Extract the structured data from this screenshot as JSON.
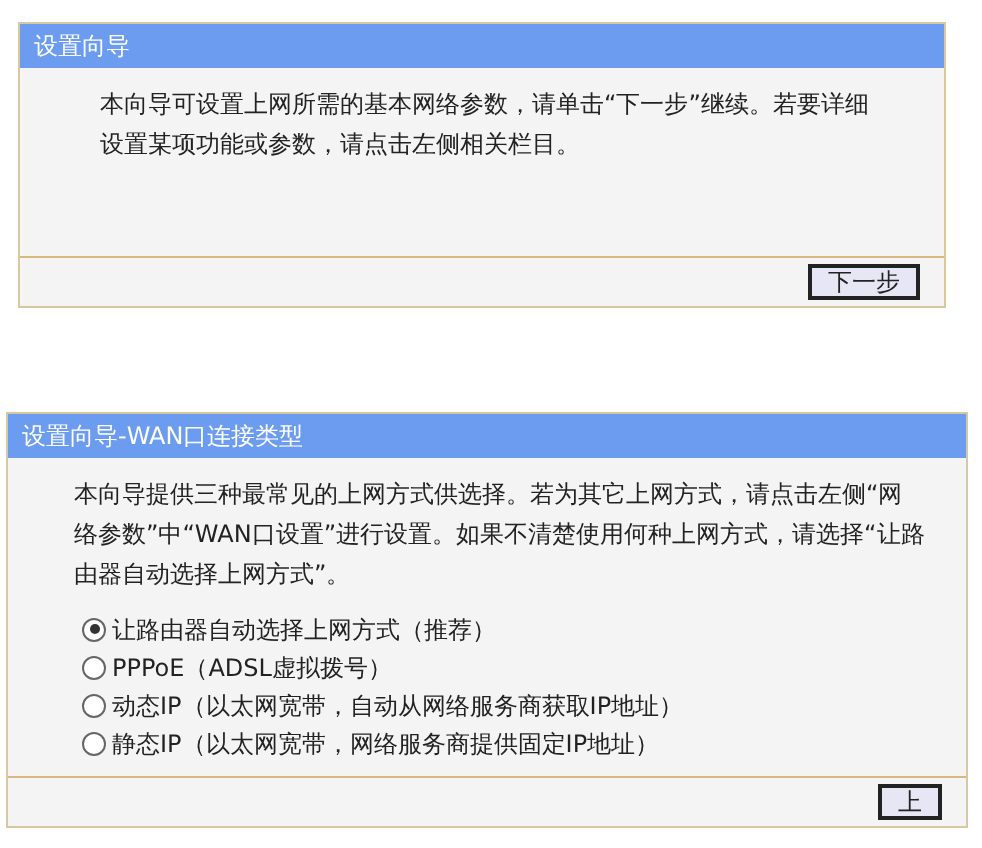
{
  "panels": [
    {
      "title": "设置向导",
      "paragraph": "本向导可设置上网所需的基本网络参数，请单击“下一步”继续。若要详细设置某项功能或参数，请点击左侧相关栏目。",
      "button": "下一步"
    },
    {
      "title": "设置向导-WAN口连接类型",
      "paragraph": "本向导提供三种最常见的上网方式供选择。若为其它上网方式，请点击左侧“网络参数”中“WAN口设置”进行设置。如果不清楚使用何种上网方式，请选择“让路由器自动选择上网方式”。",
      "options": [
        {
          "label": "让路由器自动选择上网方式（推荐）",
          "selected": true
        },
        {
          "label": "PPPoE（ADSL虚拟拨号）",
          "selected": false
        },
        {
          "label": "动态IP（以太网宽带，自动从网络服务商获取IP地址）",
          "selected": false
        },
        {
          "label": "静态IP（以太网宽带，网络服务商提供固定IP地址）",
          "selected": false
        }
      ],
      "button": "上"
    }
  ]
}
